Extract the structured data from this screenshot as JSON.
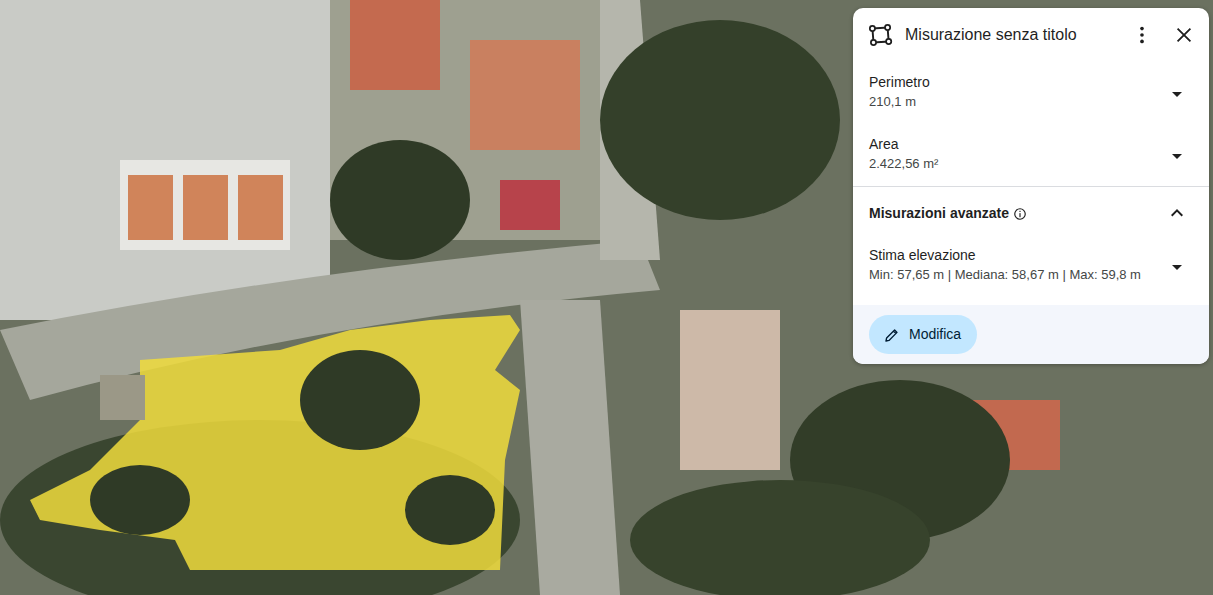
{
  "panel": {
    "title": "Misurazione senza titolo"
  },
  "measurements": [
    {
      "label": "Perimetro",
      "value": "210,1 m",
      "expanded": false
    },
    {
      "label": "Area",
      "value": "2.422,56 m²",
      "expanded": false
    }
  ],
  "advanced": {
    "label": "Misurazioni avanzate",
    "expanded": true,
    "items": [
      {
        "label": "Stima elevazione",
        "value": "Min: 57,65 m | Mediana: 58,67 m | Max: 59,8 m",
        "expanded": false
      }
    ]
  },
  "edit_button": {
    "label": "Modifica"
  }
}
